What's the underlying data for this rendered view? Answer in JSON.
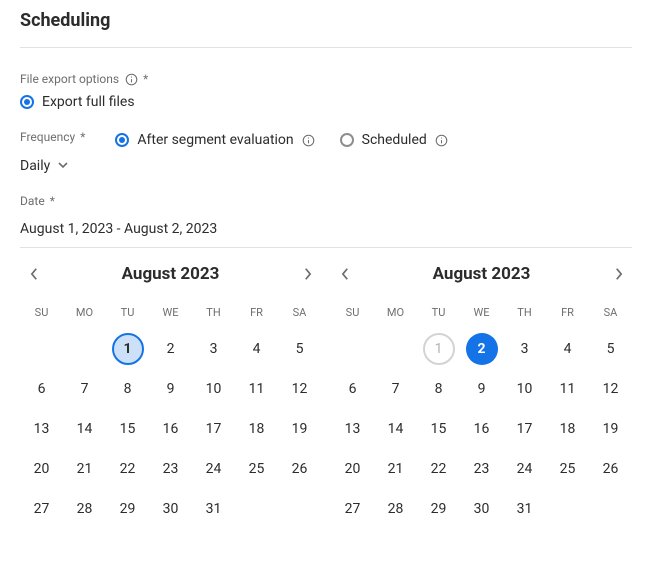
{
  "heading": "Scheduling",
  "file_export": {
    "label": "File export options",
    "option_full": "Export full files"
  },
  "frequency": {
    "label": "Frequency",
    "select_value": "Daily",
    "opt_after": "After segment evaluation",
    "opt_scheduled": "Scheduled"
  },
  "date": {
    "label": "Date",
    "range": "August 1, 2023 - August 2, 2023"
  },
  "dow": [
    "SU",
    "MO",
    "TU",
    "WE",
    "TH",
    "FR",
    "SA"
  ],
  "calendars": [
    {
      "title": "August 2023",
      "offset": 2,
      "days": 31,
      "selected_start": 1
    },
    {
      "title": "August 2023",
      "offset": 2,
      "days": 31,
      "disabled": 1,
      "selected_end": 2
    }
  ]
}
